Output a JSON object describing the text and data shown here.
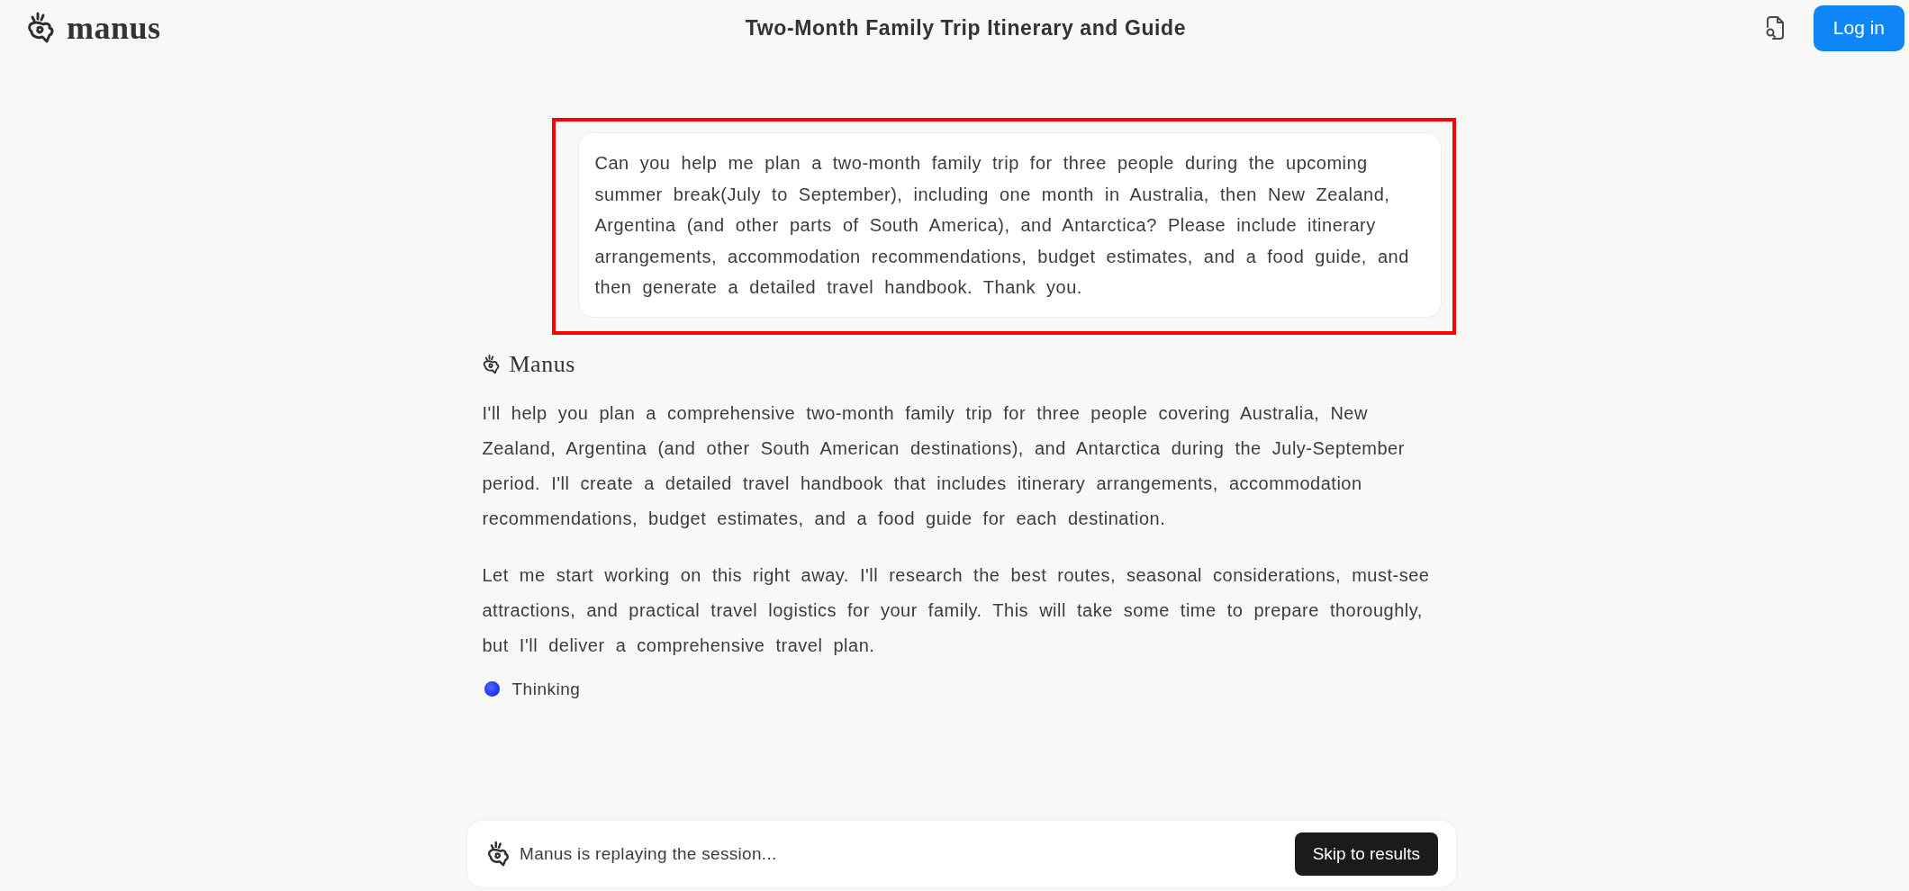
{
  "header": {
    "logo_text": "manus",
    "title": "Two-Month Family Trip Itinerary and Guide",
    "login_button": "Log in"
  },
  "user_message": {
    "text": "Can you help me plan a two-month family trip for three people during the upcoming summer break(July to September), including one month in Australia, then New Zealand, Argentina (and other parts of South America), and Antarctica? Please include itinerary arrangements, accommodation recommendations, budget estimates, and a food guide, and then generate a detailed travel handbook. Thank you.",
    "highlighted": true
  },
  "assistant": {
    "name": "Manus",
    "paragraphs": [
      "I'll help you plan a comprehensive two-month family trip for three people covering Australia, New Zealand, Argentina (and other South American destinations), and Antarctica during the July-September period. I'll create a detailed travel handbook that includes itinerary arrangements, accommodation recommendations, budget estimates, and a food guide for each destination.",
      "Let me start working on this right away. I'll research the best routes, seasonal considerations, must-see attractions, and practical travel logistics for your family. This will take some time to prepare thoroughly, but I'll deliver a comprehensive travel plan."
    ],
    "status": "Thinking"
  },
  "replay_bar": {
    "text": "Manus is replaying the session...",
    "button": "Skip to results"
  }
}
